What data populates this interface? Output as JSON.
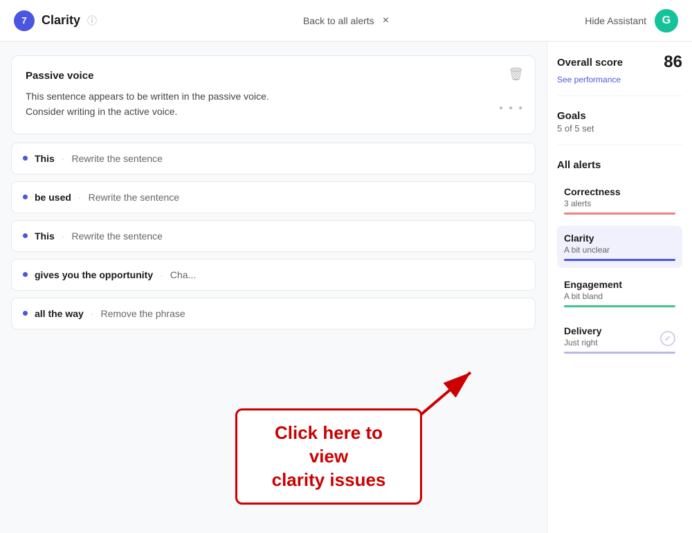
{
  "header": {
    "badge": "7",
    "title": "Clarity",
    "info_label": "ⓘ",
    "back_link": "Back to all alerts",
    "close": "×",
    "hide_assistant": "Hide Assistant",
    "grammarly_letter": "G"
  },
  "card": {
    "title": "Passive voice",
    "body_line1": "This sentence appears to be written in the passive voice.",
    "body_line2": "Consider writing in the active voice."
  },
  "list_items": [
    {
      "word": "This",
      "separator": "·",
      "action": "Rewrite the sentence"
    },
    {
      "word": "be used",
      "separator": "·",
      "action": "Rewrite the sentence"
    },
    {
      "word": "This",
      "separator": "·",
      "action": "Rewrite the sentence"
    },
    {
      "word": "gives you the opportunity",
      "separator": "·",
      "action": "Cha..."
    },
    {
      "word": "all the way",
      "separator": "·",
      "action": "Remove the phrase"
    }
  ],
  "right_panel": {
    "score_label": "Overall score",
    "score_value": "86",
    "score_sub": "See performance",
    "goals_label": "Goals",
    "goals_sub": "5 of 5 set",
    "all_alerts_label": "All alerts",
    "alerts": [
      {
        "label": "Correctness",
        "sub": "3 alerts",
        "bar_class": "bar-red",
        "active": false
      },
      {
        "label": "Clarity",
        "sub": "A bit unclear",
        "bar_class": "bar-blue",
        "active": true
      },
      {
        "label": "Engagement",
        "sub": "A bit bland",
        "bar_class": "bar-green",
        "active": false
      },
      {
        "label": "Delivery",
        "sub": "Just right",
        "bar_class": "bar-purple",
        "active": false,
        "has_check": true
      }
    ]
  },
  "callout": {
    "line1": "Click here to view",
    "line2": "clarity issues"
  }
}
